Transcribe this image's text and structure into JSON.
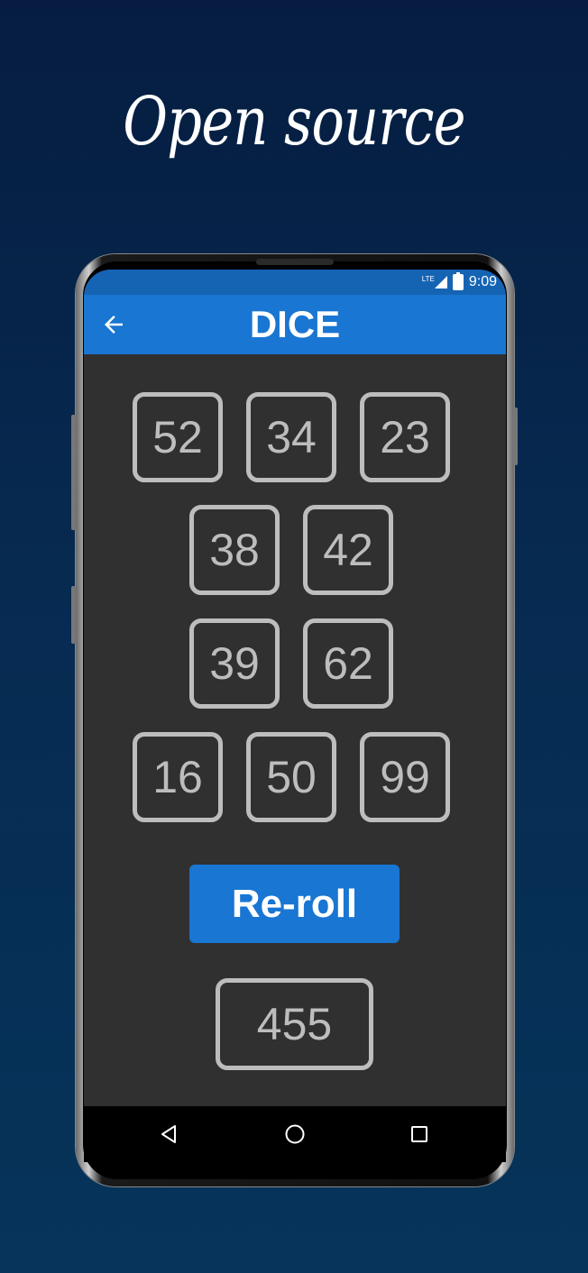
{
  "headline": "Open source",
  "status_bar": {
    "network": "LTE",
    "time": "9:09"
  },
  "app_bar": {
    "title": "DICE",
    "back_icon": "arrow-left-icon"
  },
  "dice": {
    "row1": [
      "52",
      "34",
      "23"
    ],
    "row2": [
      "38",
      "42"
    ],
    "row3": [
      "39",
      "62"
    ],
    "row4": [
      "16",
      "50",
      "99"
    ]
  },
  "reroll_label": "Re-roll",
  "total": "455",
  "nav_bar": {
    "icons": [
      "back-triangle-icon",
      "home-circle-icon",
      "recents-square-icon"
    ]
  },
  "colors": {
    "background": "#072a51",
    "app_bar": "#1976d2",
    "status_bar": "#1564b4",
    "screen_bg": "#303030",
    "die_border": "#bdbdbd",
    "button": "#1976d2"
  }
}
